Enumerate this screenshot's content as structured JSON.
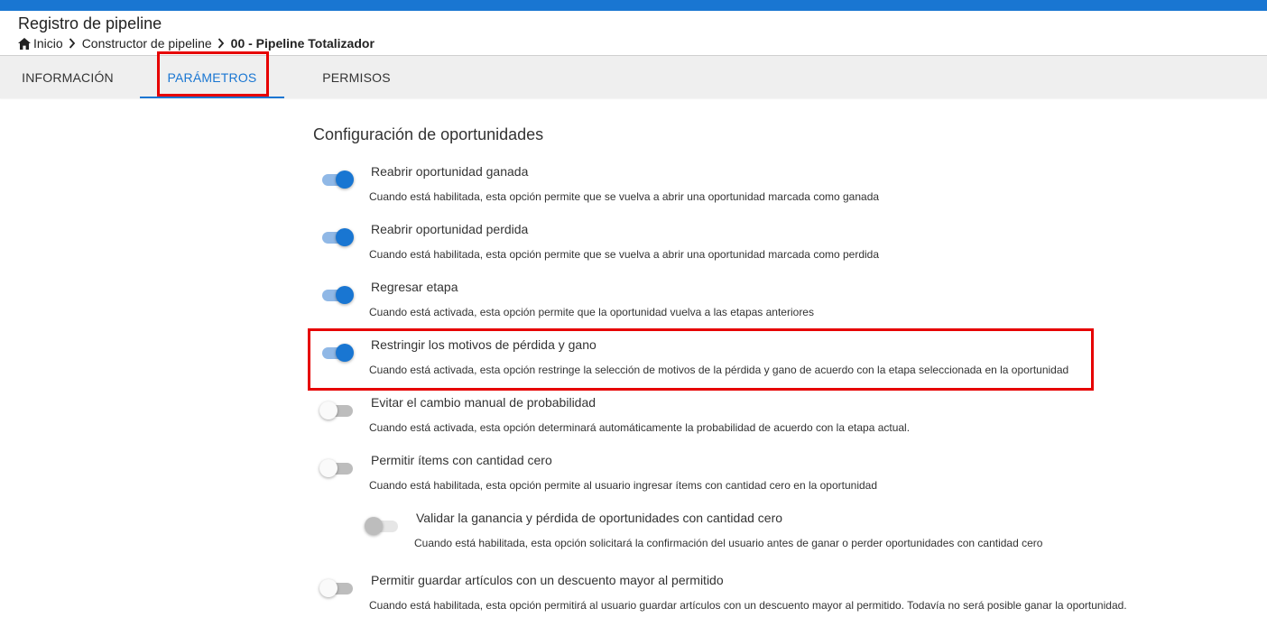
{
  "header": {
    "title": "Registro de pipeline",
    "breadcrumb": [
      "Inicio",
      "Constructor de pipeline",
      "00 - Pipeline Totalizador"
    ]
  },
  "tabs": [
    {
      "label": "INFORMACIÓN",
      "active": false
    },
    {
      "label": "PARÁMETROS",
      "active": true
    },
    {
      "label": "PERMISOS",
      "active": false
    }
  ],
  "main": {
    "section_title": "Configuración de oportunidades",
    "options": [
      {
        "title": "Reabrir oportunidad ganada",
        "description": "Cuando está habilitada, esta opción permite que se vuelva a abrir una oportunidad marcada como ganada",
        "enabled": true
      },
      {
        "title": "Reabrir oportunidad perdida",
        "description": "Cuando está habilitada, esta opción permite que se vuelva a abrir una oportunidad marcada como perdida",
        "enabled": true
      },
      {
        "title": "Regresar etapa",
        "description": "Cuando está activada, esta opción permite que la oportunidad vuelva a las etapas anteriores",
        "enabled": true
      },
      {
        "title": "Restringir los motivos de pérdida y gano",
        "description": "Cuando está activada, esta opción restringe la selección de motivos de la pérdida y gano de acuerdo con la etapa seleccionada en la oportunidad",
        "enabled": true
      },
      {
        "title": "Evitar el cambio manual de probabilidad",
        "description": "Cuando está activada, esta opción determinará automáticamente la probabilidad de acuerdo con la etapa actual.",
        "enabled": false
      },
      {
        "title": "Permitir ítems con cantidad cero",
        "description": "Cuando está habilitada, esta opción permite al usuario ingresar ítems con cantidad cero en la oportunidad",
        "enabled": false
      },
      {
        "title": "Validar la ganancia y pérdida de oportunidades con cantidad cero",
        "description": "Cuando está habilitada, esta opción solicitará la confirmación del usuario antes de ganar o perder oportunidades con cantidad cero",
        "enabled": false,
        "disabled": true
      },
      {
        "title": "Permitir guardar artículos con un descuento mayor al permitido",
        "description": "Cuando está habilitada, esta opción permitirá al usuario guardar artículos con un descuento mayor al permitido. Todavía no será posible ganar la oportunidad.",
        "enabled": false
      }
    ]
  },
  "colors": {
    "primary": "#1976d2",
    "highlight": "#e60000",
    "switch_on_track": "#90b8e6",
    "switch_off_track": "#bdbdbd"
  },
  "icons": {
    "home": "home-icon",
    "breadcrumb_separator": "chevron-right-icon"
  }
}
